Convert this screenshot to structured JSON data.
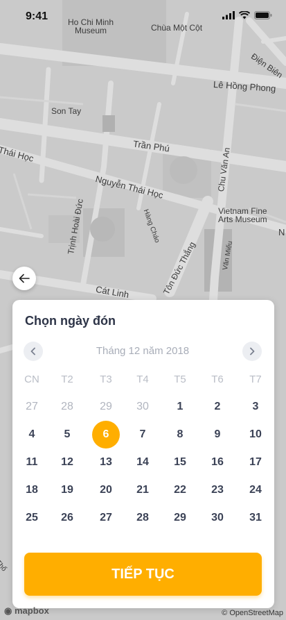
{
  "status_bar": {
    "time": "9:41"
  },
  "map": {
    "labels": {
      "ho_chi_minh_museum": "Ho Chi Minh\nMuseum",
      "chua_mot_cot": "Chùa Một Cột",
      "dien_bien": "Điện Biên",
      "le_hong_phong": "Lê Hồng Phong",
      "son_tay": "Son Tay",
      "tran_phu": "Trần Phú",
      "thai_hoc": "Thái Học",
      "chu_van_an": "Chu Văn An",
      "nguyen_thai_hoc": "Nguyễn Thái Học",
      "vietnam_fine_arts": "Vietnam Fine\nArts Museum",
      "trinh_hoai_duc": "Trịnh Hoài Đức",
      "hang_chao": "Hàng Cháo",
      "ton_duc_thang": "Tôn Đức Thắng",
      "van_mieu": "Văn Miếu",
      "cat_linh": "Cát Linh",
      "n": "N",
      "tho": "Thổ"
    },
    "attribution_mapbox": "mapbox",
    "attribution_osm": "© OpenStreetMap"
  },
  "picker": {
    "title": "Chọn ngày đón",
    "month_label": "Tháng 12 năm 2018",
    "weekdays": [
      "CN",
      "T2",
      "T3",
      "T4",
      "T5",
      "T6",
      "T7"
    ],
    "weeks": [
      [
        {
          "d": "27",
          "m": true
        },
        {
          "d": "28",
          "m": true
        },
        {
          "d": "29",
          "m": true
        },
        {
          "d": "30",
          "m": true
        },
        {
          "d": "1"
        },
        {
          "d": "2"
        },
        {
          "d": "3"
        }
      ],
      [
        {
          "d": "4"
        },
        {
          "d": "5"
        },
        {
          "d": "6",
          "sel": true
        },
        {
          "d": "7"
        },
        {
          "d": "8"
        },
        {
          "d": "9"
        },
        {
          "d": "10"
        }
      ],
      [
        {
          "d": "11"
        },
        {
          "d": "12"
        },
        {
          "d": "13"
        },
        {
          "d": "14"
        },
        {
          "d": "15"
        },
        {
          "d": "16"
        },
        {
          "d": "17"
        }
      ],
      [
        {
          "d": "18"
        },
        {
          "d": "19"
        },
        {
          "d": "20"
        },
        {
          "d": "21"
        },
        {
          "d": "22"
        },
        {
          "d": "23"
        },
        {
          "d": "24"
        }
      ],
      [
        {
          "d": "25"
        },
        {
          "d": "26"
        },
        {
          "d": "27"
        },
        {
          "d": "28"
        },
        {
          "d": "29"
        },
        {
          "d": "30"
        },
        {
          "d": "31"
        }
      ]
    ],
    "selected_day": "6",
    "continue_label": "TIẾP TỤC"
  },
  "colors": {
    "accent": "#ffae00",
    "text": "#2d3447",
    "muted": "#b1b5bf"
  }
}
